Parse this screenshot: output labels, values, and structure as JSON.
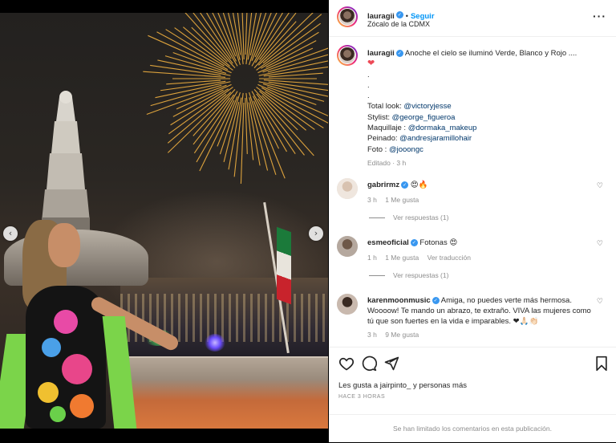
{
  "post": {
    "username": "lauragii",
    "follow_label": "Seguir",
    "separator": "•",
    "location": "Zócalo de la CDMX",
    "more_label": "···"
  },
  "caption": {
    "username": "lauragii",
    "line1": "Anoche el cielo se iluminó Verde, Blanco y Rojo ....",
    "heart": "❤",
    "dots": [
      ".",
      ".",
      "."
    ],
    "credits": [
      {
        "label": "Total look: ",
        "handle": "@victoryjesse"
      },
      {
        "label": "Stylist: ",
        "handle": "@george_figueroa"
      },
      {
        "label": "Maquillaje : ",
        "handle": "@dormaka_makeup"
      },
      {
        "label": "Peinado: ",
        "handle": "@andresjaramillohair"
      },
      {
        "label": "Foto : ",
        "handle": "@jooongc"
      }
    ],
    "meta": "Editado · 3 h"
  },
  "comments": [
    {
      "username": "gabrirmz",
      "text": "😍🔥",
      "time": "3 h",
      "likes": "1 Me gusta",
      "translate": "",
      "replies": "Ver respuestas (1)"
    },
    {
      "username": "esmeoficial",
      "text": "Fotonas 😍",
      "time": "1 h",
      "likes": "1 Me gusta",
      "translate": "Ver traducción",
      "replies": "Ver respuestas (1)"
    },
    {
      "username": "karenmoonmusic",
      "text": "Amiga, no puedes verte más hermosa. Woooow! Te mando un abrazo, te extraño. VIVA las mujeres como tú que son fuertes en la vida e imparables. ❤🙏🏻👏🏻",
      "time": "3 h",
      "likes": "9 Me gusta",
      "translate": "",
      "replies": ""
    }
  ],
  "actions": {
    "liked_by": "Les gusta a jairpinto_ y personas más",
    "time_ago": "HACE 3 HORAS",
    "comments_limited": "Se han limitado los comentarios en esta publicación."
  },
  "carousel": {
    "prev": "‹",
    "next": "›"
  },
  "icons": [
    "heart-icon",
    "comment-icon",
    "share-icon",
    "bookmark-icon",
    "more-options-icon",
    "verified-icon"
  ],
  "colors": {
    "link": "#00376b",
    "follow": "#0095f6",
    "verified": "#3897f0",
    "muted": "#8e8e8e"
  }
}
